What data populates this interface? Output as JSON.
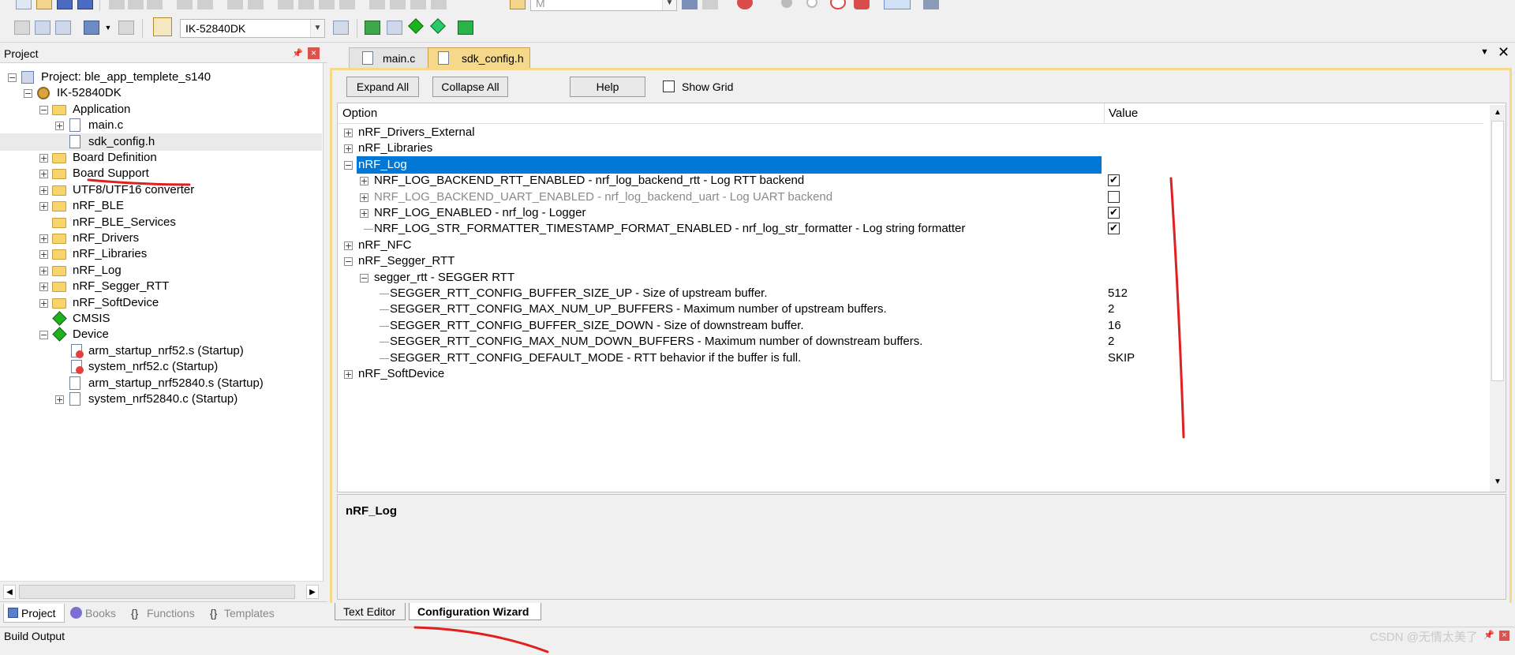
{
  "toolbar": {
    "target_combo": "M",
    "device_combo": "IK-52840DK"
  },
  "project_pane": {
    "title": "Project",
    "pin_glyph": "⼇",
    "close_glyph": "×",
    "tree": [
      {
        "label": "Project: ble_app_templete_s140",
        "depth": 0,
        "expander": "minus",
        "icon": "project-icon"
      },
      {
        "label": "IK-52840DK",
        "depth": 1,
        "expander": "minus",
        "icon": "target-gear-icon"
      },
      {
        "label": "Application",
        "depth": 2,
        "expander": "minus",
        "icon": "folder-icon"
      },
      {
        "label": "main.c",
        "depth": 3,
        "expander": "plus",
        "icon": "file-icon"
      },
      {
        "label": "sdk_config.h",
        "depth": 3,
        "expander": "none",
        "icon": "file-icon",
        "selected": true
      },
      {
        "label": "Board Definition",
        "depth": 2,
        "expander": "plus",
        "icon": "folder-icon"
      },
      {
        "label": "Board Support",
        "depth": 2,
        "expander": "plus",
        "icon": "folder-icon"
      },
      {
        "label": "UTF8/UTF16 converter",
        "depth": 2,
        "expander": "plus",
        "icon": "folder-icon"
      },
      {
        "label": "nRF_BLE",
        "depth": 2,
        "expander": "plus",
        "icon": "folder-icon"
      },
      {
        "label": "nRF_BLE_Services",
        "depth": 2,
        "expander": "none",
        "icon": "folder-icon"
      },
      {
        "label": "nRF_Drivers",
        "depth": 2,
        "expander": "plus",
        "icon": "folder-icon"
      },
      {
        "label": "nRF_Libraries",
        "depth": 2,
        "expander": "plus",
        "icon": "folder-icon"
      },
      {
        "label": "nRF_Log",
        "depth": 2,
        "expander": "plus",
        "icon": "folder-icon"
      },
      {
        "label": "nRF_Segger_RTT",
        "depth": 2,
        "expander": "plus",
        "icon": "folder-icon"
      },
      {
        "label": "nRF_SoftDevice",
        "depth": 2,
        "expander": "plus",
        "icon": "folder-icon"
      },
      {
        "label": "CMSIS",
        "depth": 2,
        "expander": "none",
        "icon": "diamond-icon"
      },
      {
        "label": "Device",
        "depth": 2,
        "expander": "minus",
        "icon": "diamond-icon"
      },
      {
        "label": "arm_startup_nrf52.s (Startup)",
        "depth": 3,
        "expander": "none",
        "icon": "startup-file-icon"
      },
      {
        "label": "system_nrf52.c (Startup)",
        "depth": 3,
        "expander": "none",
        "icon": "startup-file-icon"
      },
      {
        "label": "arm_startup_nrf52840.s (Startup)",
        "depth": 3,
        "expander": "none",
        "icon": "file-icon"
      },
      {
        "label": "system_nrf52840.c (Startup)",
        "depth": 3,
        "expander": "plus",
        "icon": "file-icon"
      }
    ],
    "tabs": [
      {
        "label": "Project",
        "active": true
      },
      {
        "label": "Books",
        "active": false
      },
      {
        "label": "Functions",
        "active": false
      },
      {
        "label": "Templates",
        "active": false
      }
    ]
  },
  "editor": {
    "tabs": [
      {
        "label": "main.c",
        "active": false
      },
      {
        "label": "sdk_config.h",
        "active": true
      }
    ],
    "buttons": {
      "expand_all": "Expand All",
      "collapse_all": "Collapse All",
      "help": "Help",
      "show_grid": "Show Grid"
    },
    "columns": {
      "option": "Option",
      "value": "Value"
    },
    "rows": [
      {
        "label": "nRF_Drivers_External",
        "depth": 0,
        "expander": "plus"
      },
      {
        "label": "nRF_Libraries",
        "depth": 0,
        "expander": "plus"
      },
      {
        "label": "nRF_Log",
        "depth": 0,
        "expander": "minus",
        "selected": true
      },
      {
        "label": "NRF_LOG_BACKEND_RTT_ENABLED - nrf_log_backend_rtt - Log RTT backend",
        "depth": 1,
        "expander": "plus",
        "check": true
      },
      {
        "label": "NRF_LOG_BACKEND_UART_ENABLED - nrf_log_backend_uart - Log UART backend",
        "depth": 1,
        "expander": "plus",
        "check": false,
        "disabled": true
      },
      {
        "label": "NRF_LOG_ENABLED - nrf_log - Logger",
        "depth": 1,
        "expander": "plus",
        "check": true
      },
      {
        "label": "NRF_LOG_STR_FORMATTER_TIMESTAMP_FORMAT_ENABLED  - nrf_log_str_formatter - Log string formatter",
        "depth": 1,
        "expander": "none",
        "check": true
      },
      {
        "label": "nRF_NFC",
        "depth": 0,
        "expander": "plus"
      },
      {
        "label": "nRF_Segger_RTT",
        "depth": 0,
        "expander": "minus"
      },
      {
        "label": "segger_rtt - SEGGER RTT",
        "depth": 1,
        "expander": "minus"
      },
      {
        "label": "SEGGER_RTT_CONFIG_BUFFER_SIZE_UP - Size of upstream buffer.",
        "depth": 2,
        "expander": "none",
        "value": "512"
      },
      {
        "label": "SEGGER_RTT_CONFIG_MAX_NUM_UP_BUFFERS - Maximum number of upstream buffers.",
        "depth": 2,
        "expander": "none",
        "value": "2"
      },
      {
        "label": "SEGGER_RTT_CONFIG_BUFFER_SIZE_DOWN - Size of downstream buffer.",
        "depth": 2,
        "expander": "none",
        "value": "16"
      },
      {
        "label": "SEGGER_RTT_CONFIG_MAX_NUM_DOWN_BUFFERS - Maximum number of downstream buffers.",
        "depth": 2,
        "expander": "none",
        "value": "2"
      },
      {
        "label": "SEGGER_RTT_CONFIG_DEFAULT_MODE  - RTT behavior if the buffer is full.",
        "depth": 2,
        "expander": "none",
        "value": "SKIP"
      },
      {
        "label": "nRF_SoftDevice",
        "depth": 0,
        "expander": "plus"
      }
    ],
    "description": "nRF_Log",
    "bottom_tabs": [
      {
        "label": "Text Editor",
        "active": false
      },
      {
        "label": "Configuration Wizard",
        "active": true
      }
    ]
  },
  "build_output": {
    "title": "Build Output"
  },
  "watermark": "CSDN @无情太美了",
  "colors": {
    "selection": "#0078d7",
    "annotation_red": "#e02020",
    "tab_highlight": "#f6d88a"
  }
}
